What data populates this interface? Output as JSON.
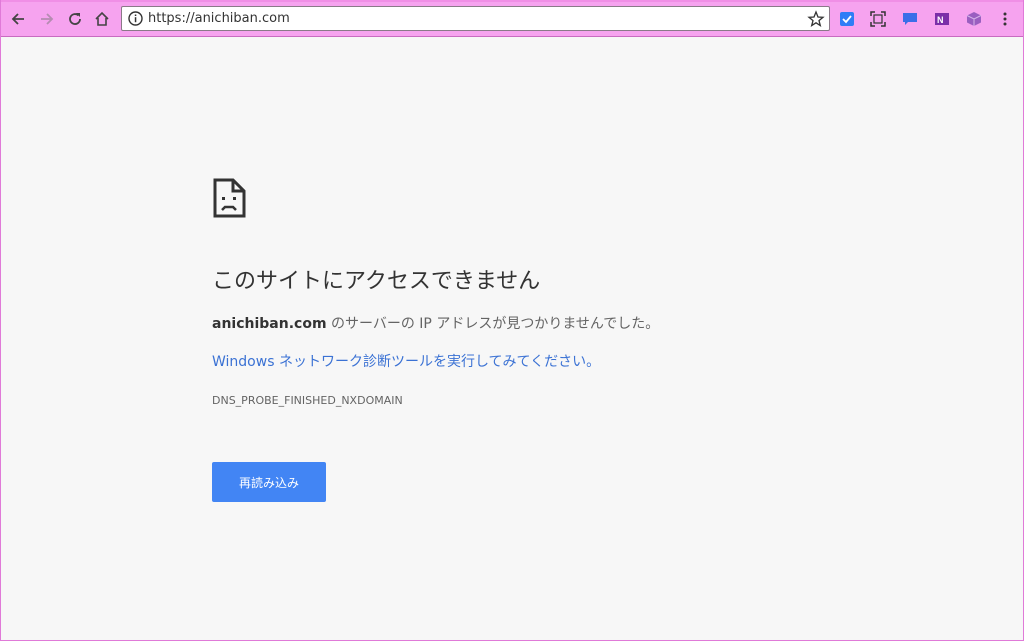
{
  "browser": {
    "url": "https://anichiban.com",
    "buttons": {
      "back": "back-icon",
      "forward": "forward-icon",
      "reload": "reload-icon",
      "home": "home-icon"
    },
    "extensions": [
      "todo-check-icon",
      "screenshot-icon",
      "comment-icon",
      "onenote-icon",
      "cube-icon",
      "menu-icon"
    ],
    "accent_color": "#f6a3ef"
  },
  "error_page": {
    "icon": "sad-page-icon",
    "heading": "このサイトにアクセスできません",
    "domain": "anichiban.com",
    "message": " のサーバーの IP アドレスが見つかりませんでした。",
    "diagnose_link": "Windows ネットワーク診断ツールを実行してみてください。",
    "error_code": "DNS_PROBE_FINISHED_NXDOMAIN",
    "reload_label": "再読み込み",
    "button_color": "#4285f4",
    "link_color": "#3b72d4"
  }
}
